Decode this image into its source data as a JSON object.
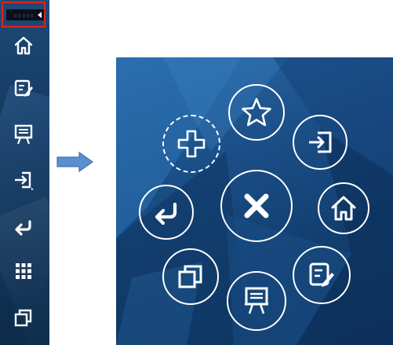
{
  "sidebar": {
    "top_bar_text": "□ □ □ □ □",
    "items": [
      {
        "name": "home",
        "icon": "home-icon"
      },
      {
        "name": "edit",
        "icon": "edit-icon"
      },
      {
        "name": "presentation",
        "icon": "presentation-icon"
      },
      {
        "name": "enter",
        "icon": "enter-icon"
      },
      {
        "name": "return",
        "icon": "return-icon"
      },
      {
        "name": "apps",
        "icon": "grid-icon"
      },
      {
        "name": "windows",
        "icon": "window-stack-icon"
      }
    ]
  },
  "arrow": {
    "icon": "right-arrow-icon",
    "color": "#5b8fd0"
  },
  "radial_menu": {
    "center": {
      "icon": "close-icon"
    },
    "items": [
      {
        "name": "add",
        "icon": "plus-icon",
        "style": "dashed"
      },
      {
        "name": "favorite",
        "icon": "star-icon"
      },
      {
        "name": "enter",
        "icon": "enter-icon"
      },
      {
        "name": "home",
        "icon": "home-icon"
      },
      {
        "name": "edit",
        "icon": "edit-icon"
      },
      {
        "name": "presentation",
        "icon": "presentation-icon"
      },
      {
        "name": "windows",
        "icon": "window-stack-icon"
      },
      {
        "name": "return",
        "icon": "return-icon"
      }
    ]
  },
  "colors": {
    "sidebar_bg": "#163f68",
    "panel_bg": "#1b4f88",
    "highlight_border": "#e0241e",
    "icon": "#ffffff"
  }
}
